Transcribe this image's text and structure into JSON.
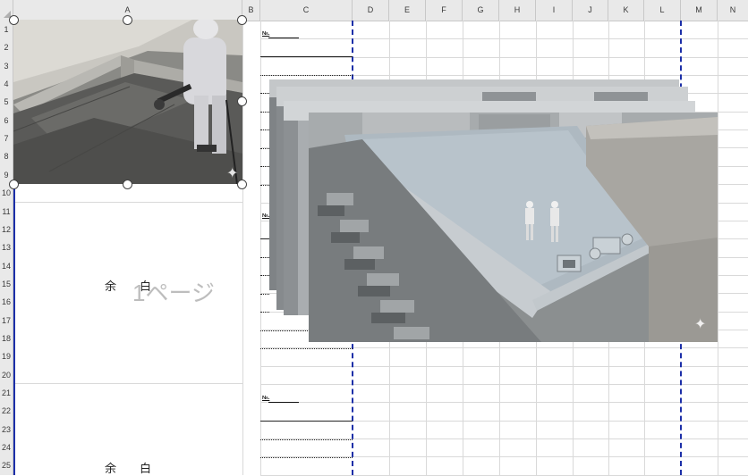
{
  "columns": [
    "A",
    "B",
    "C",
    "D",
    "E",
    "F",
    "G",
    "H",
    "I",
    "J",
    "K",
    "L",
    "M",
    "N"
  ],
  "rows": [
    "1",
    "2",
    "3",
    "4",
    "5",
    "6",
    "7",
    "8",
    "9",
    "10",
    "11",
    "12",
    "13",
    "14",
    "15",
    "16",
    "17",
    "18",
    "19",
    "20",
    "21",
    "22",
    "23",
    "24",
    "25"
  ],
  "cells": {
    "no_label_1": "№.",
    "no_label_2": "№.",
    "no_label_3": "№.",
    "yohaku_1": "余白",
    "yohaku_2": "余白",
    "page_watermark": "1ページ"
  },
  "colors": {
    "page_break": "#1c2fa8",
    "grid": "#d9d9d9",
    "header_bg": "#e9e9e9"
  },
  "icons": {
    "sparkle": "✦"
  }
}
